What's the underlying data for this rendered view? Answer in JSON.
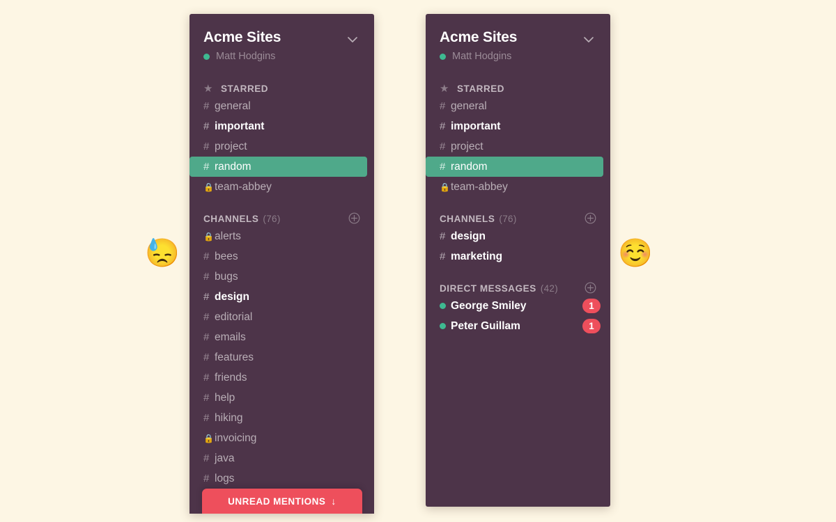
{
  "background_color": "#fdf6e4",
  "panel_color": "#4d3449",
  "accent_green": "#4fa98a",
  "accent_red": "#ee4f5c",
  "presence_green": "#3eb991",
  "left_panel": {
    "team": {
      "name": "Acme Sites",
      "user": "Matt Hodgins",
      "chevron_icon": "chevron-down-icon",
      "presence_icon": "presence-dot-online"
    },
    "starred": {
      "title": "STARRED",
      "star_icon": "star-icon",
      "items": [
        {
          "sigil": "#",
          "label": "general",
          "state": "read"
        },
        {
          "sigil": "#",
          "label": "important",
          "state": "unread"
        },
        {
          "sigil": "#",
          "label": "project",
          "state": "read"
        },
        {
          "sigil": "#",
          "label": "random",
          "state": "active"
        },
        {
          "sigil": "lock",
          "label": "team-abbey",
          "state": "read"
        }
      ]
    },
    "channels": {
      "title": "CHANNELS",
      "count": "(76)",
      "add_icon": "plus-circle-icon",
      "items": [
        {
          "sigil": "lock",
          "label": "alerts",
          "state": "read"
        },
        {
          "sigil": "#",
          "label": "bees",
          "state": "read"
        },
        {
          "sigil": "#",
          "label": "bugs",
          "state": "read"
        },
        {
          "sigil": "#",
          "label": "design",
          "state": "unread"
        },
        {
          "sigil": "#",
          "label": "editorial",
          "state": "read"
        },
        {
          "sigil": "#",
          "label": "emails",
          "state": "read"
        },
        {
          "sigil": "#",
          "label": "features",
          "state": "read"
        },
        {
          "sigil": "#",
          "label": "friends",
          "state": "read"
        },
        {
          "sigil": "#",
          "label": "help",
          "state": "read"
        },
        {
          "sigil": "#",
          "label": "hiking",
          "state": "read"
        },
        {
          "sigil": "lock",
          "label": "invoicing",
          "state": "read"
        },
        {
          "sigil": "#",
          "label": "java",
          "state": "read"
        },
        {
          "sigil": "#",
          "label": "logs",
          "state": "read"
        }
      ]
    },
    "unread_mentions": {
      "label": "UNREAD MENTIONS",
      "arrow": "↓",
      "arrow_icon": "arrow-down-icon"
    }
  },
  "right_panel": {
    "team": {
      "name": "Acme Sites",
      "user": "Matt Hodgins",
      "chevron_icon": "chevron-down-icon",
      "presence_icon": "presence-dot-online"
    },
    "starred": {
      "title": "STARRED",
      "star_icon": "star-icon",
      "items": [
        {
          "sigil": "#",
          "label": "general",
          "state": "read"
        },
        {
          "sigil": "#",
          "label": "important",
          "state": "unread"
        },
        {
          "sigil": "#",
          "label": "project",
          "state": "read"
        },
        {
          "sigil": "#",
          "label": "random",
          "state": "active"
        },
        {
          "sigil": "lock",
          "label": "team-abbey",
          "state": "read"
        }
      ]
    },
    "channels": {
      "title": "CHANNELS",
      "count": "(76)",
      "add_icon": "plus-circle-icon",
      "items": [
        {
          "sigil": "#",
          "label": "design",
          "state": "unread"
        },
        {
          "sigil": "#",
          "label": "marketing",
          "state": "unread"
        }
      ]
    },
    "direct_messages": {
      "title": "DIRECT MESSAGES",
      "count": "(42)",
      "add_icon": "plus-circle-icon",
      "items": [
        {
          "label": "George Smiley",
          "badge": "1",
          "presence": "online"
        },
        {
          "label": "Peter Guillam",
          "badge": "1",
          "presence": "online"
        }
      ]
    }
  },
  "annotations": {
    "left_emoji": "😓",
    "right_emoji": "☺️"
  }
}
